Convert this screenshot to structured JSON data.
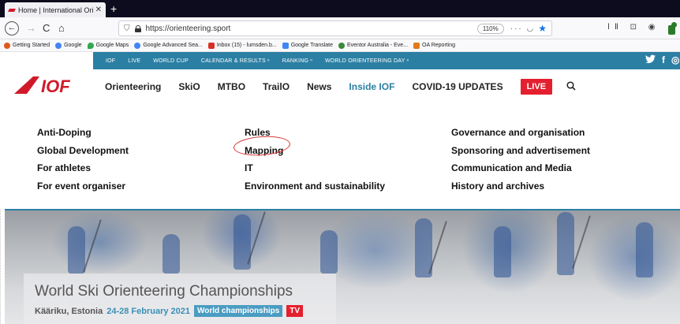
{
  "browser": {
    "tab": {
      "title": "Home | International Orienteer",
      "close": "✕"
    },
    "new_tab": "+",
    "nav": {
      "back": "←",
      "forward": "→",
      "reload": "C",
      "home": "⌂"
    },
    "url": "https://orienteering.sport",
    "zoom": "110%",
    "url_icons": "··· ◡",
    "star": "★",
    "tools": "ⅠⅡ ⊡ ◉"
  },
  "bookmarks": [
    {
      "label": "Getting Started",
      "color": "#e05a1a"
    },
    {
      "label": "Google",
      "color": "#4285f4"
    },
    {
      "label": "Google Maps",
      "color": "#34a853"
    },
    {
      "label": "Google Advanced Sea...",
      "color": "#4285f4"
    },
    {
      "label": "Inbox (15) - lumsden.b...",
      "color": "#d93025"
    },
    {
      "label": "Google Translate",
      "color": "#4285f4"
    },
    {
      "label": "Eventor Australia - Eve...",
      "color": "#3a8a3a"
    },
    {
      "label": "OA Reporting",
      "color": "#e07a1a"
    }
  ],
  "site": {
    "top_links": [
      "IOF",
      "LIVE",
      "WORLD CUP",
      "CALENDAR & RESULTS ⁿ",
      "RANKING ⁿ",
      "WORLD ORIENTEERING DAY ⁿ"
    ],
    "social": {
      "twitter": "🐦",
      "facebook": "f",
      "instagram": "◎"
    },
    "logo_text": "IOF",
    "menu": [
      "Orienteering",
      "SkiO",
      "MTBO",
      "TrailO",
      "News",
      "Inside IOF",
      "COVID-19 UPDATES"
    ],
    "live": "LIVE",
    "search": "🔍"
  },
  "dropdown": {
    "col1": [
      "Anti-Doping",
      "Global Development",
      "For athletes",
      "For event organiser"
    ],
    "col2": [
      "Rules",
      "Mapping",
      "IT",
      "Environment and sustainability"
    ],
    "col3": [
      "Governance and organisation",
      "Sponsoring and advertisement",
      "Communication and Media",
      "History and archives"
    ]
  },
  "hero": {
    "title": "World Ski Orienteering Championships",
    "location": "Kääriku, Estonia",
    "dates": "24-28 February 2021",
    "badge": "World championships",
    "tv": "TV"
  },
  "colors": {
    "accent": "#2b7fa3",
    "live": "#e4202f",
    "logo_red": "#d01a2a"
  }
}
